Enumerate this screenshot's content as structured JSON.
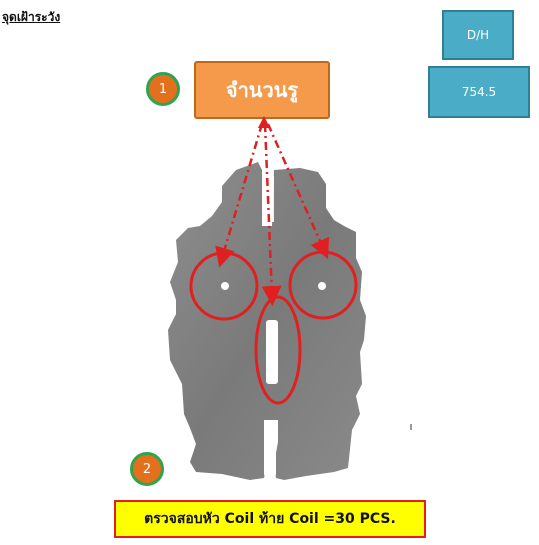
{
  "title": "จุดเฝ้าระวัง",
  "dh_label": "D/H",
  "dh_value": "754.5",
  "hole_count_label": "จำนวนรู",
  "steps": [
    {
      "number": "1"
    },
    {
      "number": "2"
    }
  ],
  "note": "ตรวจสอบหัว Coil ท้าย Coil =30 PCS.",
  "colors": {
    "accent_blue": "#4aacc6",
    "accent_orange": "#f59a4a",
    "highlight_red": "#e02020",
    "note_yellow": "#ffff00"
  }
}
